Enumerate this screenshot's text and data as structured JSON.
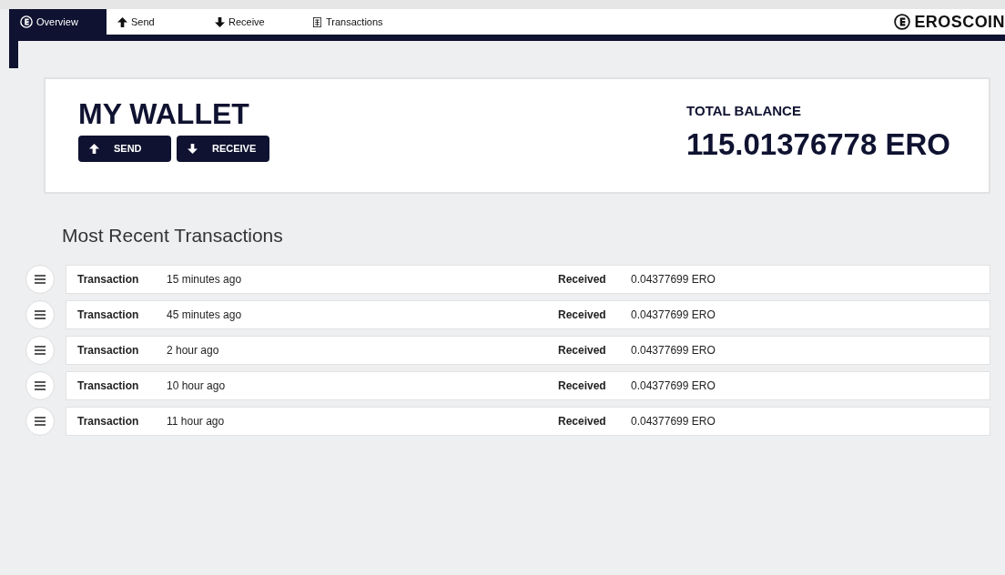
{
  "tabs": [
    {
      "label": "Overview",
      "kind": "coin",
      "selected": true
    },
    {
      "label": "Send",
      "kind": "up",
      "selected": false
    },
    {
      "label": "Receive",
      "kind": "down",
      "selected": false
    },
    {
      "label": "Transactions",
      "kind": "ledger",
      "selected": false
    }
  ],
  "brand": "EROSCOIN",
  "wallet": {
    "title": "MY WALLET",
    "buttons": [
      {
        "label": "SEND",
        "kind": "up"
      },
      {
        "label": "RECEIVE",
        "kind": "down"
      }
    ],
    "balance_label": "TOTAL BALANCE",
    "balance": "115.01376778 ERO"
  },
  "recent": {
    "heading": "Most Recent Transactions",
    "rows": [
      {
        "type": "Transaction",
        "time": "15 minutes ago",
        "status": "Received",
        "amount": "0.04377699 ERO"
      },
      {
        "type": "Transaction",
        "time": "45 minutes ago",
        "status": "Received",
        "amount": "0.04377699 ERO"
      },
      {
        "type": "Transaction",
        "time": "2 hour ago",
        "status": "Received",
        "amount": "0.04377699 ERO"
      },
      {
        "type": "Transaction",
        "time": "10 hour ago",
        "status": "Received",
        "amount": "0.04377699 ERO"
      },
      {
        "type": "Transaction",
        "time": "11 hour ago",
        "status": "Received",
        "amount": "0.04377699 ERO"
      }
    ]
  }
}
